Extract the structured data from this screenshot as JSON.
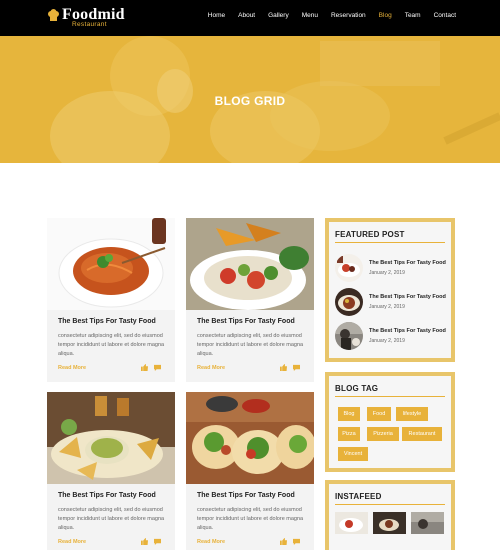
{
  "nav": {
    "logo_name": "Foodmid",
    "logo_sub": "Restaurant",
    "items": [
      {
        "label": "Home",
        "active": false
      },
      {
        "label": "About",
        "active": false
      },
      {
        "label": "Gallery",
        "active": false
      },
      {
        "label": "Menu",
        "active": false
      },
      {
        "label": "Reservation",
        "active": false
      },
      {
        "label": "Blog",
        "active": true
      },
      {
        "label": "Team",
        "active": false
      },
      {
        "label": "Contact",
        "active": false
      }
    ]
  },
  "hero": {
    "title": "BLOG GRID"
  },
  "posts": [
    {
      "title": "The Best Tips For Tasty Food",
      "excerpt": "consectetur adipiscing elit, sed do eiusmod tempor incididunt ut labore et dolore magna aliqua.",
      "read_more": "Read More",
      "image": "spaghetti"
    },
    {
      "title": "The Best Tips For Tasty Food",
      "excerpt": "consectetur adipiscing elit, sed do eiusmod tempor incididunt ut labore et dolore magna aliqua.",
      "read_more": "Read More",
      "image": "salad-plate"
    },
    {
      "title": "The Best Tips For Tasty Food",
      "excerpt": "consectetur adipiscing elit, sed do eiusmod tempor incididunt ut labore et dolore magna aliqua.",
      "read_more": "Read More",
      "image": "nachos"
    },
    {
      "title": "The Best Tips For Tasty Food",
      "excerpt": "consectetur adipiscing elit, sed do eiusmod tempor incididunt ut labore et dolore magna aliqua.",
      "read_more": "Read More",
      "image": "tacos"
    }
  ],
  "featured": {
    "title": "FEATURED POST",
    "items": [
      {
        "title": "The Best Tips For Tasty Food",
        "date": "January 2, 2019"
      },
      {
        "title": "The Best Tips For Tasty Food",
        "date": "January 2, 2019"
      },
      {
        "title": "The Best Tips For Tasty Food",
        "date": "January 2, 2019"
      }
    ]
  },
  "tags": {
    "title": "BLOG TAG",
    "items": [
      "Blog",
      "Food",
      "lifestyle",
      "Pizza",
      "Pizzeria",
      "Restaurant",
      "Vincent"
    ]
  },
  "instafeed": {
    "title": "INSTAFEED"
  },
  "colors": {
    "accent": "#e8b23a",
    "nav_bg": "#000000",
    "hero_bg": "#e6b53c",
    "card_bg": "#f3f3f3"
  },
  "icons": {
    "like": "thumbs-up-icon",
    "comment": "comment-icon"
  }
}
